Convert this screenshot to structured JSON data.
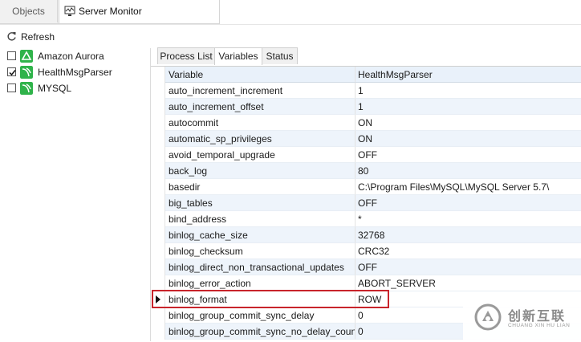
{
  "tabs": {
    "objects_label": "Objects",
    "server_monitor_label": "Server Monitor"
  },
  "toolbar": {
    "refresh_label": "Refresh"
  },
  "servers": [
    {
      "label": "Amazon Aurora",
      "checked": false,
      "icon": "aurora-icon"
    },
    {
      "label": "HealthMsgParser",
      "checked": true,
      "icon": "mysql-icon"
    },
    {
      "label": "MYSQL",
      "checked": false,
      "icon": "mysql-icon"
    }
  ],
  "sub_tabs": [
    "Process List",
    "Variables",
    "Status"
  ],
  "grid": {
    "header": {
      "variable": "Variable",
      "value": "HealthMsgParser"
    },
    "rows": [
      {
        "variable": "auto_increment_increment",
        "value": "1"
      },
      {
        "variable": "auto_increment_offset",
        "value": "1"
      },
      {
        "variable": "autocommit",
        "value": "ON"
      },
      {
        "variable": "automatic_sp_privileges",
        "value": "ON"
      },
      {
        "variable": "avoid_temporal_upgrade",
        "value": "OFF"
      },
      {
        "variable": "back_log",
        "value": "80"
      },
      {
        "variable": "basedir",
        "value": "C:\\Program Files\\MySQL\\MySQL Server 5.7\\"
      },
      {
        "variable": "big_tables",
        "value": "OFF"
      },
      {
        "variable": "bind_address",
        "value": "*"
      },
      {
        "variable": "binlog_cache_size",
        "value": "32768"
      },
      {
        "variable": "binlog_checksum",
        "value": "CRC32"
      },
      {
        "variable": "binlog_direct_non_transactional_updates",
        "value": "OFF"
      },
      {
        "variable": "binlog_error_action",
        "value": "ABORT_SERVER"
      },
      {
        "variable": "binlog_format",
        "value": "ROW"
      },
      {
        "variable": "binlog_group_commit_sync_delay",
        "value": "0"
      },
      {
        "variable": "binlog_group_commit_sync_no_delay_count",
        "value": "0"
      }
    ]
  },
  "watermark": {
    "cn": "创新互联",
    "en": "CHUANG XIN HU LIAN"
  },
  "colors": {
    "highlight": "#c8242b",
    "server_icon": "#2fb34a",
    "row_alt": "#eef4fb"
  }
}
